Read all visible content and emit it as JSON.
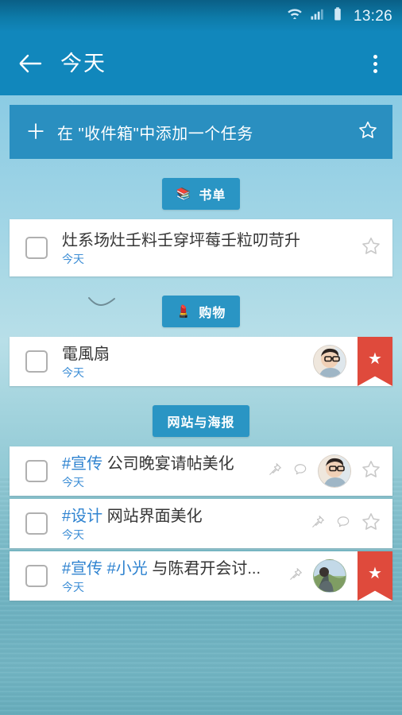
{
  "status_bar": {
    "wifi_icon": "wifi-icon",
    "signal_icon": "cellular-signal-icon",
    "battery_icon": "battery-icon",
    "time": "13:26"
  },
  "toolbar": {
    "back_icon": "back-arrow-icon",
    "title": "今天",
    "overflow_icon": "overflow-menu-icon"
  },
  "add_task_bar": {
    "plus_icon": "plus-icon",
    "label": "在 \"收件箱\"中添加一个任务",
    "star_icon": "star-outline-icon"
  },
  "colors": {
    "toolbar": "#1187bc",
    "status_bar": "#0d7aa8",
    "badge": "#2a95c4",
    "add_bar": "#2a8fc0",
    "ribbon_red": "#df4a3c",
    "tag_blue": "#2f83d0",
    "date_blue": "#3f8fd6",
    "card_white": "#ffffff"
  },
  "sections": [
    {
      "emoji": "📚",
      "label": "书单",
      "tasks": [
        {
          "title_tags": "",
          "title": "灶系场灶壬料壬穿坪莓壬粒叨苛升",
          "date": "今天",
          "pin": false,
          "comment": false,
          "avatar": "",
          "star": "outline",
          "ribbon": false
        }
      ]
    },
    {
      "emoji": "💄",
      "label": "购物",
      "tasks": [
        {
          "title_tags": "",
          "title": "電風扇",
          "date": "今天",
          "pin": false,
          "comment": false,
          "avatar": "indoor",
          "star": "ribbon",
          "ribbon": true
        }
      ]
    },
    {
      "emoji": "",
      "label": "网站与海报",
      "tasks": [
        {
          "title_tags": "#宣传",
          "title": "公司晚宴请帖美化",
          "date": "今天",
          "pin": true,
          "comment": true,
          "avatar": "indoor",
          "star": "outline",
          "ribbon": false
        },
        {
          "title_tags": "#设计",
          "title": "网站界面美化",
          "date": "今天",
          "pin": true,
          "comment": true,
          "avatar": "",
          "star": "outline",
          "ribbon": false
        },
        {
          "title_tags": "#宣传 #小光",
          "title": "与陈君开会讨...",
          "date": "今天",
          "pin": true,
          "comment": false,
          "avatar": "outdoor",
          "star": "ribbon",
          "ribbon": true
        }
      ]
    }
  ],
  "icons": {
    "pin": "pin-icon",
    "comment": "comment-bubble-icon",
    "star_outline": "star-outline-icon",
    "star_filled": "star-filled-icon",
    "checkbox": "checkbox-unchecked-icon"
  }
}
